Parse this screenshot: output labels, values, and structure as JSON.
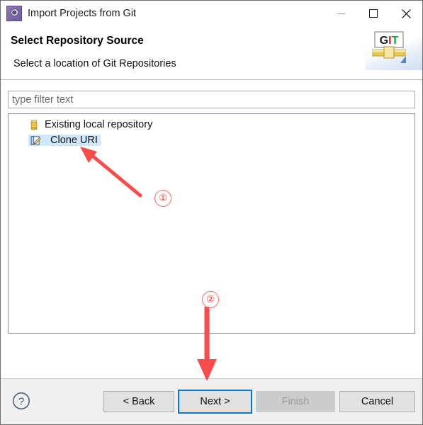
{
  "window": {
    "title": "Import Projects from Git",
    "icon": "git-import-gear-icon",
    "controls": {
      "minimize": "minimize-icon",
      "maximize": "maximize-icon",
      "close": "close-icon"
    }
  },
  "header": {
    "title": "Select Repository Source",
    "subtitle": "Select a location of Git Repositories",
    "banner_logo_text": "GIT",
    "banner_logo_letters": [
      "G",
      "I",
      "T"
    ],
    "banner_logo_colors": [
      "#1a1a1a",
      "#d31b1b",
      "#1aa03c"
    ]
  },
  "filter": {
    "placeholder": "type filter text",
    "value": ""
  },
  "tree": {
    "items": [
      {
        "label": "Existing local repository",
        "icon": "repository-cylinder-icon",
        "selected": false
      },
      {
        "label": "Clone URI",
        "icon": "clone-uri-page-pencil-icon",
        "selected": true
      }
    ]
  },
  "footer": {
    "help_icon": "help-question-icon",
    "buttons": [
      {
        "id": "back",
        "label": "< Back",
        "state": "enabled"
      },
      {
        "id": "next",
        "label": "Next >",
        "state": "enabled-focused"
      },
      {
        "id": "finish",
        "label": "Finish",
        "state": "disabled"
      },
      {
        "id": "cancel",
        "label": "Cancel",
        "state": "enabled"
      }
    ]
  },
  "annotations": {
    "color": "#fb4b4b",
    "markers": [
      {
        "number": "①",
        "target": "Clone URI",
        "arrow": "diagonal-up-left"
      },
      {
        "number": "②",
        "target": "Next >",
        "arrow": "straight-down"
      }
    ]
  },
  "colors": {
    "accent_focus": "#0078d7",
    "selection": "#cde8ff",
    "footer_bg": "#f0f0f0",
    "annotation_red": "#fb4b4b"
  }
}
